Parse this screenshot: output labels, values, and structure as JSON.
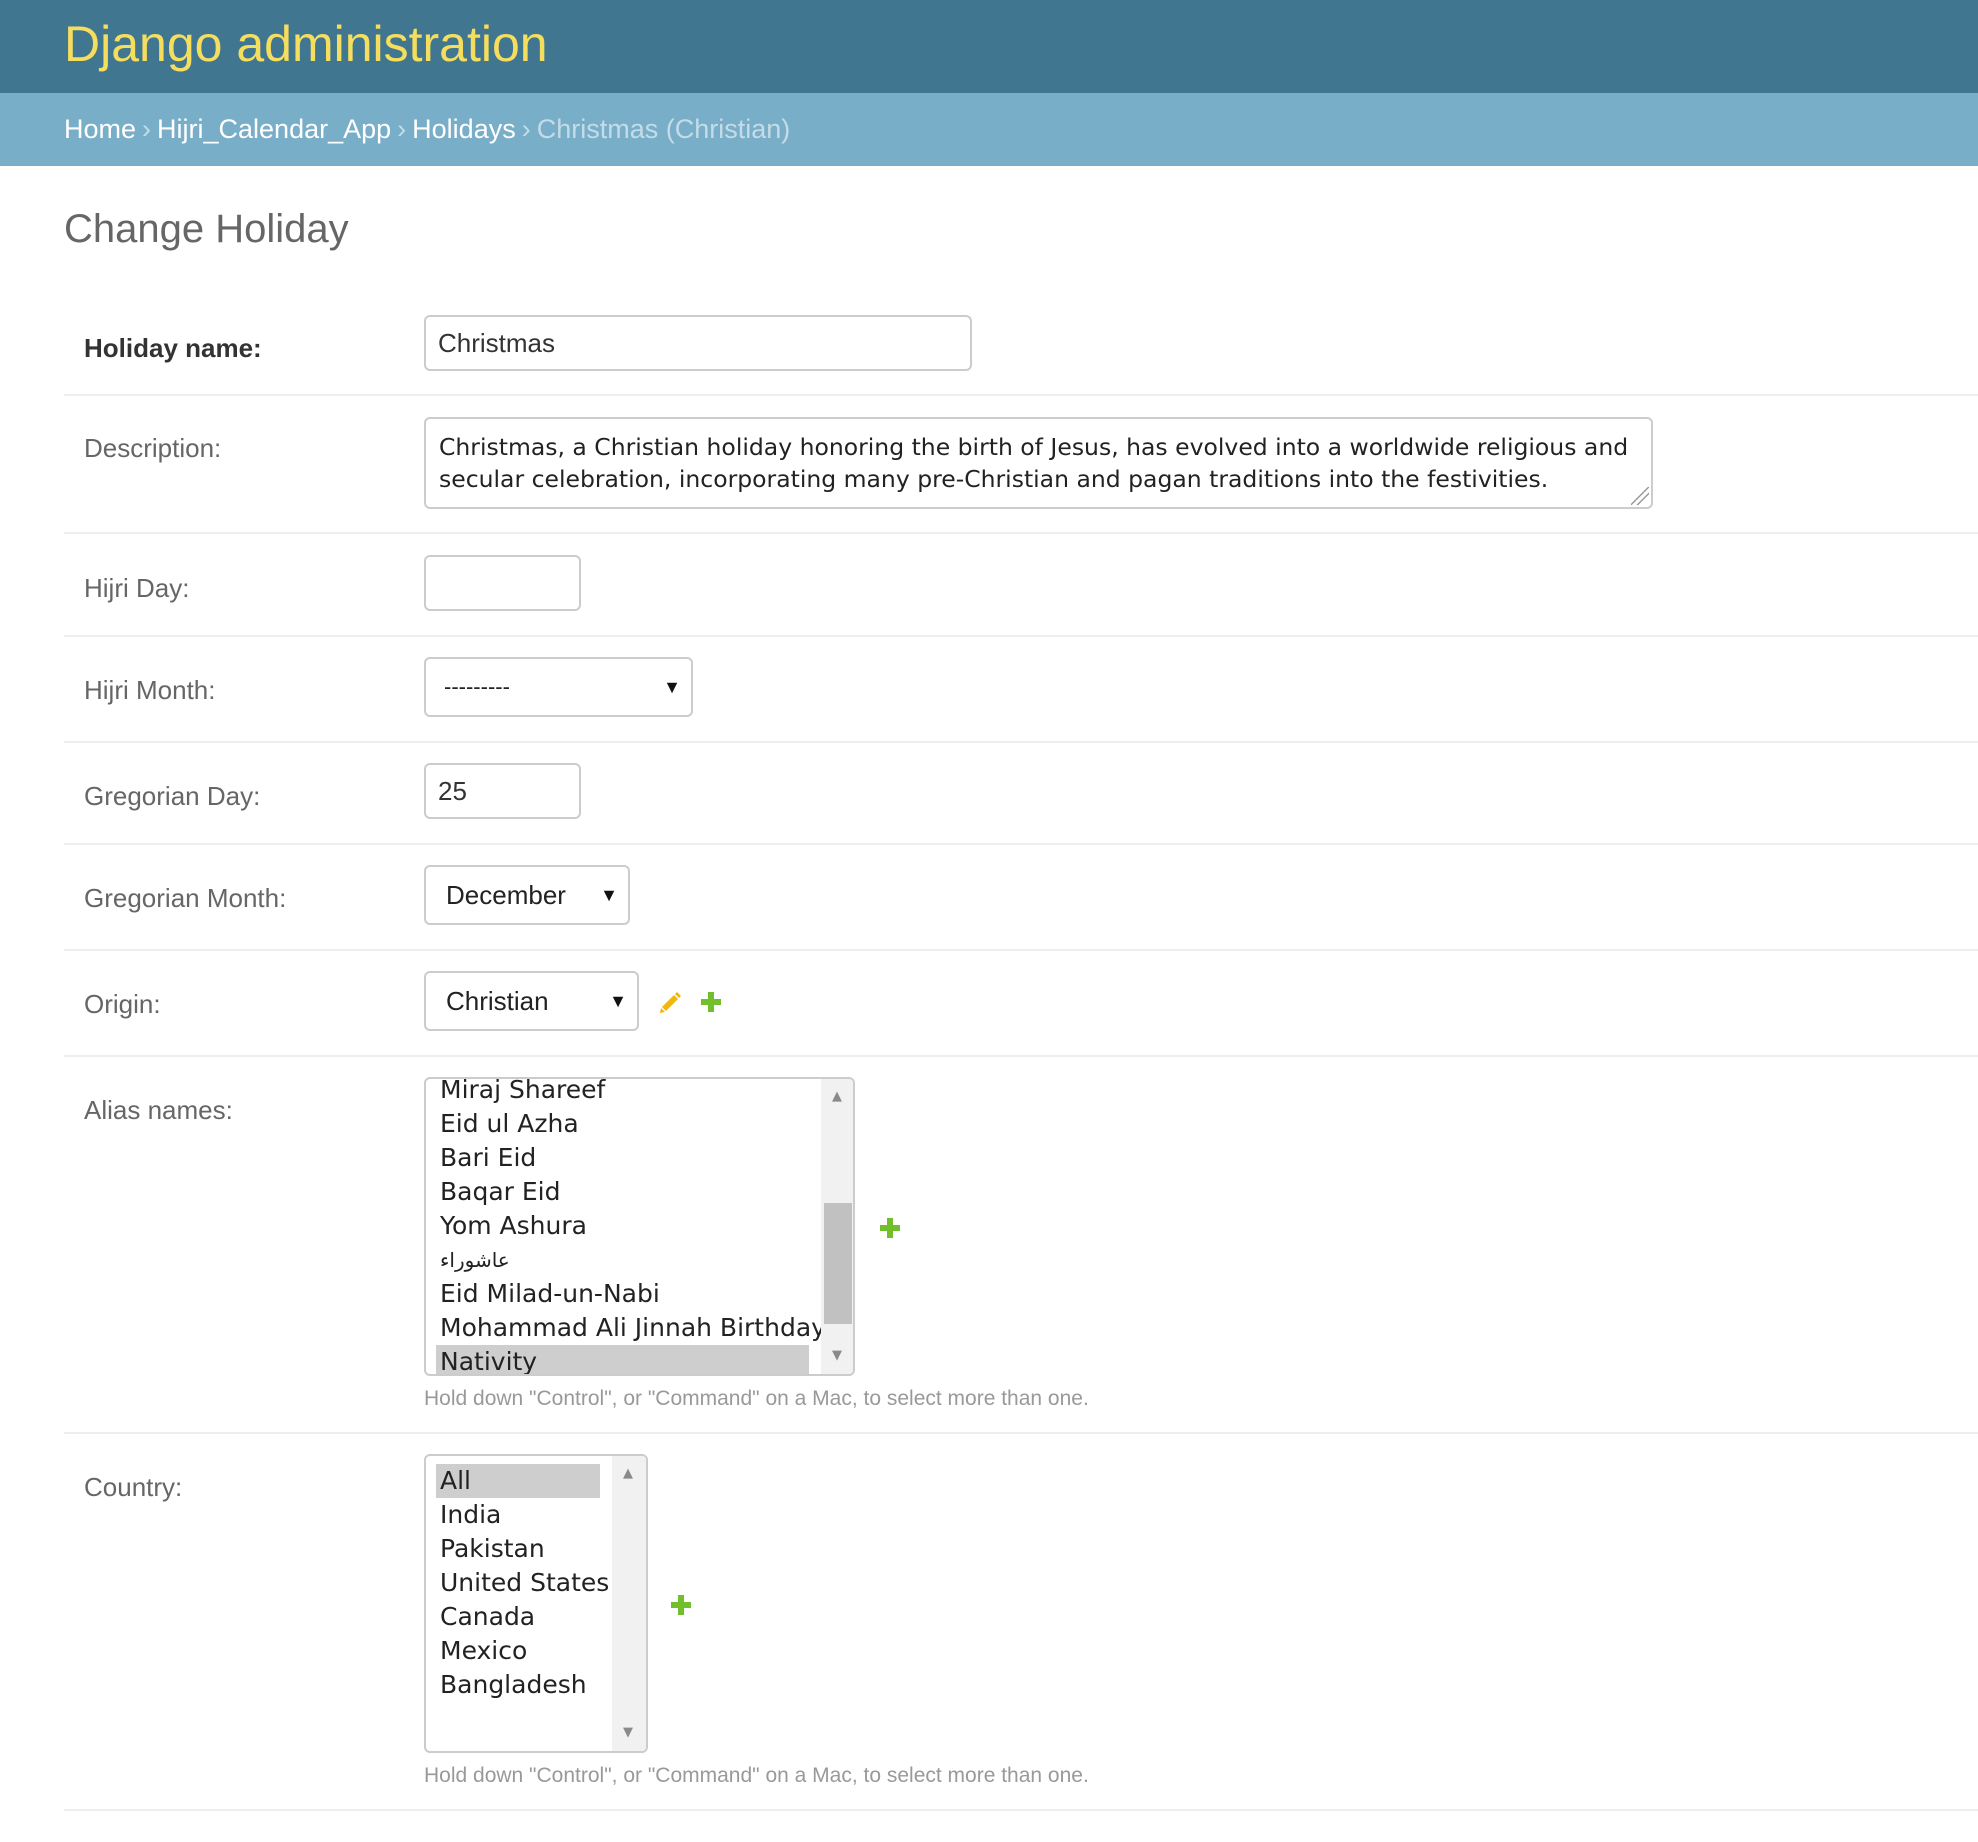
{
  "header": {
    "title": "Django administration"
  },
  "breadcrumbs": {
    "home": "Home",
    "app": "Hijri_Calendar_App",
    "model": "Holidays",
    "current": "Christmas (Christian)",
    "separator": "›"
  },
  "page": {
    "title": "Change Holiday"
  },
  "form": {
    "holiday_name": {
      "label": "Holiday name:",
      "value": "Christmas"
    },
    "description": {
      "label": "Description:",
      "value": "Christmas, a Christian holiday honoring the birth of Jesus, has evolved into a worldwide religious and secular celebration, incorporating many pre-Christian and pagan traditions into the festivities."
    },
    "hijri_day": {
      "label": "Hijri Day:",
      "value": ""
    },
    "hijri_month": {
      "label": "Hijri Month:",
      "selected": "---------"
    },
    "gregorian_day": {
      "label": "Gregorian Day:",
      "value": "25"
    },
    "gregorian_month": {
      "label": "Gregorian Month:",
      "selected": "December"
    },
    "origin": {
      "label": "Origin:",
      "selected": "Christian"
    },
    "alias_names": {
      "label": "Alias names:",
      "options": [
        "Miraj Shareef",
        "Eid ul Azha",
        "Bari Eid",
        "Baqar Eid",
        "Yom Ashura",
        "عاشوراء",
        "Eid Milad-un-Nabi",
        "Mohammad Ali Jinnah Birthday",
        "Nativity"
      ],
      "selected": [
        "Nativity"
      ],
      "help": "Hold down \"Control\", or \"Command\" on a Mac, to select more than one."
    },
    "country": {
      "label": "Country:",
      "options": [
        "All",
        "India",
        "Pakistan",
        "United States",
        "Canada",
        "Mexico",
        "Bangladesh"
      ],
      "selected": [
        "All"
      ],
      "help": "Hold down \"Control\", or \"Command\" on a Mac, to select more than one."
    }
  },
  "icons": {
    "change": "pencil-icon",
    "add": "plus-icon",
    "dropdown": "chevron-down-icon",
    "scroll_up": "scroll-up-arrow-icon",
    "scroll_down": "scroll-down-arrow-icon",
    "dropdown_glyph": "▼",
    "scroll_up_glyph": "▲",
    "scroll_down_glyph": "▼"
  },
  "colors": {
    "header_bg": "#417690",
    "branding": "#f5dd5d",
    "breadcrumbs_bg": "#79aec8",
    "add_icon": "#70bf2b",
    "change_icon": "#efb80b"
  }
}
